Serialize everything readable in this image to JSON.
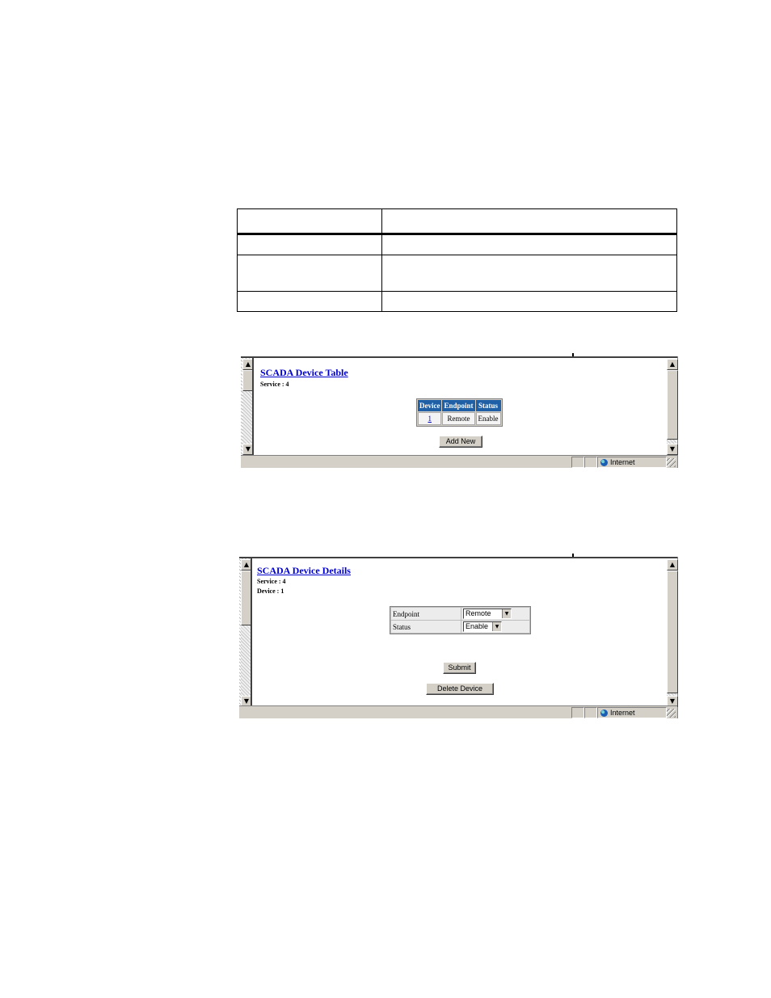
{
  "screen1": {
    "title": "SCADA Device Table",
    "service": "Service : 4",
    "table": {
      "headers": [
        "Device",
        "Endpoint",
        "Status"
      ],
      "rows": [
        [
          "1",
          "Remote",
          "Enable"
        ]
      ]
    },
    "add_new_label": "Add New",
    "status_zone": "Internet"
  },
  "screen2": {
    "title": "SCADA Device Details",
    "service": "Service : 4",
    "device": "Device : 1",
    "fields": [
      {
        "label": "Endpoint",
        "value": "Remote"
      },
      {
        "label": "Status",
        "value": "Enable"
      }
    ],
    "submit_label": "Submit",
    "delete_label": "Delete Device",
    "status_zone": "Internet"
  },
  "icons": {
    "scroll_up": "▲",
    "scroll_down": "▼",
    "dropdown": "▼"
  }
}
